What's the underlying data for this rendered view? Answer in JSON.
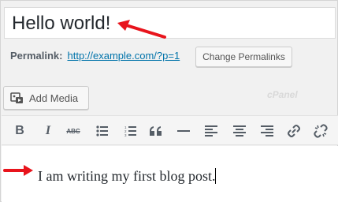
{
  "post": {
    "title": "Hello world!",
    "content": "I am writing my first blog post."
  },
  "permalink": {
    "label": "Permalink:",
    "url": "http://example.com/?p=1",
    "change_button": "Change Permalinks"
  },
  "media": {
    "add_button": "Add Media"
  },
  "watermark": {
    "text": "cPanel"
  },
  "toolbar": {
    "buttons": [
      "bold",
      "italic",
      "strikethrough",
      "bulleted-list",
      "numbered-list",
      "blockquote",
      "horizontal-line",
      "align-left",
      "align-center",
      "align-right",
      "insert-link",
      "remove-link"
    ],
    "strike_glyph": "ABC"
  },
  "colors": {
    "annotation_arrow": "#e8141c",
    "link": "#0073aa"
  }
}
